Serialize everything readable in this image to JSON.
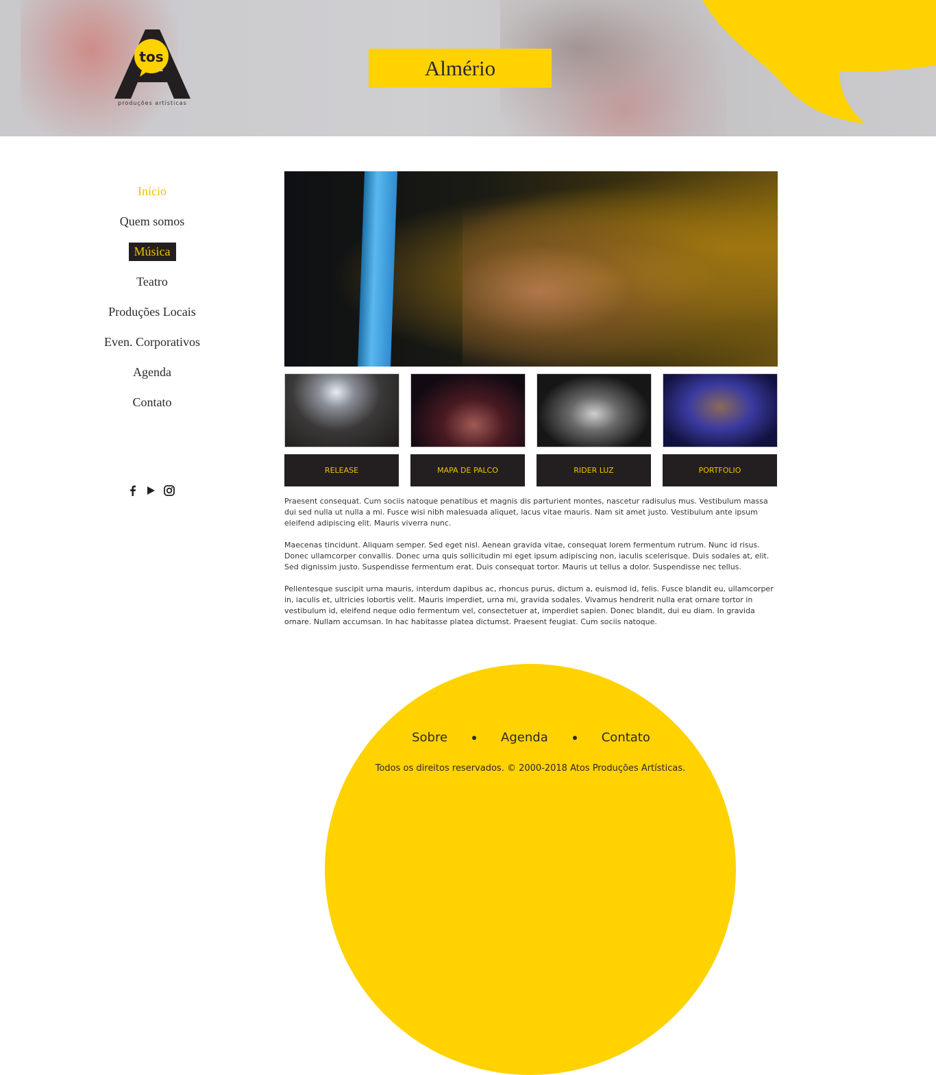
{
  "header": {
    "logo_text": "tos",
    "logo_subtitle": "produções artísticas",
    "title": "Almério"
  },
  "sidebar": {
    "items": [
      {
        "label": "Início"
      },
      {
        "label": "Quem somos"
      },
      {
        "label": "Música"
      },
      {
        "label": "Teatro"
      },
      {
        "label": "Produções Locais"
      },
      {
        "label": "Even. Corporativos"
      },
      {
        "label": "Agenda"
      },
      {
        "label": "Contato"
      }
    ],
    "social": [
      "facebook-icon",
      "play-icon",
      "instagram-icon"
    ]
  },
  "main": {
    "buttons": [
      {
        "label": "RELEASE"
      },
      {
        "label": "MAPA DE PALCO"
      },
      {
        "label": "RIDER LUZ"
      },
      {
        "label": "PORTFOLIO"
      }
    ],
    "paragraphs": [
      "Praesent consequat. Cum sociis natoque penatibus et magnis dis parturient montes, nascetur radisulus mus. Vestibulum massa dui sed nulla ut nulla a mi. Fusce wisi nibh malesuada aliquet, lacus vitae mauris. Nam sit amet justo. Vestibulum ante ipsum eleifend adipiscing elit. Mauris viverra nunc.",
      "Maecenas tincidunt. Aliquam semper. Sed eget nisl. Aenean gravida vitae, consequat lorem fermentum rutrum. Nunc id risus. Donec ullamcorper convallis. Donec urna quis sollicitudin mi eget ipsum adipiscing non, iaculis scelerisque. Duis sodales at, elit. Sed dignissim justo. Suspendisse fermentum erat. Duis consequat tortor. Mauris ut tellus a dolor. Suspendisse nec tellus.",
      "Pellentesque suscipit urna mauris, interdum dapibus ac, rhoncus purus, dictum a, euismod id, felis. Fusce blandit eu, ullamcorper in, iaculis et, ultricies lobortis velit. Mauris imperdiet, urna mi, gravida sodales. Vivamus hendrerit nulla erat ornare tortor in vestibulum id, eleifend neque odio fermentum vel, consectetuer at, imperdiet sapien. Donec blandit, dui eu diam. In gravida ornare. Nullam accumsan. In hac habitasse platea dictumst. Praesent feugiat. Cum sociis natoque."
    ]
  },
  "footer": {
    "links": [
      {
        "label": "Sobre"
      },
      {
        "label": "Agenda"
      },
      {
        "label": "Contato"
      }
    ],
    "copyright": "Todos os direitos reservados. © 2000-2018 Atos Produções Artísticas."
  },
  "colors": {
    "accent": "#ffd200",
    "dark": "#231f20",
    "nav_active": "#f2c200"
  }
}
